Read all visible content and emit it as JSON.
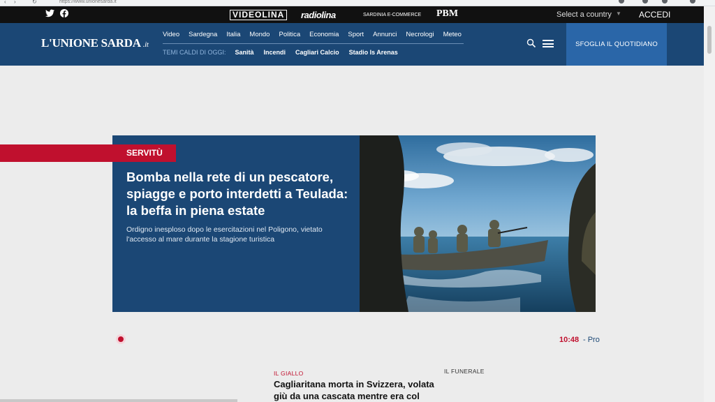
{
  "browser": {
    "url": "https://www.unionesarda.it"
  },
  "topbar": {
    "brands": [
      "VIDEOLINA",
      "radiolina",
      "SARDINIA E-COMMERCE",
      "PBM"
    ],
    "country_select": "Select a country",
    "login": "ACCEDI"
  },
  "header": {
    "logo": "L'UNIONE SARDA",
    "logo_tld": ".it",
    "nav": [
      "Video",
      "Sardegna",
      "Italia",
      "Mondo",
      "Politica",
      "Economia",
      "Sport",
      "Annunci",
      "Necrologi",
      "Meteo"
    ],
    "hot_label": "TEMI CALDI DI OGGI:",
    "hot_topics": [
      "Sanità",
      "Incendi",
      "Cagliari Calcio",
      "Stadio Is Arenas"
    ],
    "sfoglia": "SFOGLIA IL QUOTIDIANO"
  },
  "hero": {
    "kicker": "SERVITÙ",
    "headline": "Bomba nella rete di un pescatore, spiagge e porto interdetti a Teulada: la beffa in piena estate",
    "summary": "Ordigno inesploso dopo le esercitazioni nel Poligono, vietato l'accesso al mare durante la stagione turistica"
  },
  "live": {
    "time": "10:48",
    "label": "- Pro"
  },
  "cards": [
    {
      "kicker": "IL GIALLO",
      "title": "Cagliaritana morta in Svizzera, volata giù da una cascata mentre era col"
    },
    {
      "kicker": "IL FUNERALE"
    }
  ],
  "colors": {
    "navy": "#1b4775",
    "accent_red": "#c0102e",
    "sfoglia_blue": "#2a66a8"
  }
}
